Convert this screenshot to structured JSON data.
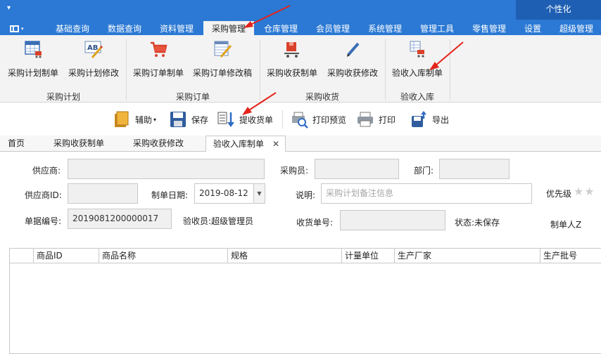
{
  "window": {
    "personalize_label": "个性化",
    "qat_symbol": "▾"
  },
  "menu_tabs": [
    {
      "label": "基础查询"
    },
    {
      "label": "数据查询"
    },
    {
      "label": "资料管理"
    },
    {
      "label": "采购管理",
      "active": true
    },
    {
      "label": "仓库管理"
    },
    {
      "label": "会员管理"
    },
    {
      "label": "系统管理"
    },
    {
      "label": "管理工具"
    },
    {
      "label": "零售管理"
    },
    {
      "label": "设置"
    },
    {
      "label": "超级管理"
    }
  ],
  "ribbon": {
    "groups": [
      {
        "title": "采购计划",
        "buttons": [
          {
            "label": "采购计划制单",
            "icon": "calendar-cart-icon"
          },
          {
            "label": "采购计划修改",
            "icon": "ab-edit-icon"
          }
        ]
      },
      {
        "title": "采购订单",
        "buttons": [
          {
            "label": "采购订单制单",
            "icon": "shopping-cart-icon"
          },
          {
            "label": "采购订单修改稿",
            "icon": "table-edit-icon"
          }
        ]
      },
      {
        "title": "采购收货",
        "buttons": [
          {
            "label": "采购收获制单",
            "icon": "box-cart-icon"
          },
          {
            "label": "采购收获修改",
            "icon": "pencil-icon"
          }
        ]
      },
      {
        "title": "验收入库",
        "buttons": [
          {
            "label": "验收入库制单",
            "icon": "warehouse-cart-icon"
          }
        ]
      }
    ]
  },
  "toolbar": {
    "assist_label": "辅助",
    "save_label": "保存",
    "pull_label": "提收货单",
    "preview_label": "打印预览",
    "print_label": "打印",
    "export_label": "导出"
  },
  "doc_tabs": [
    {
      "label": "首页"
    },
    {
      "label": "采购收获制单"
    },
    {
      "label": "采购收获修改"
    },
    {
      "label": "验收入库制单",
      "active": true,
      "closable": true
    }
  ],
  "doc_tab_close": "✕",
  "form": {
    "supplier_label": "供应商:",
    "supplier_value": "",
    "buyer_label": "采购员:",
    "buyer_value": "",
    "dept_label": "部门:",
    "dept_value": "",
    "supplier_id_label": "供应商ID:",
    "supplier_id_value": "",
    "date_label": "制单日期:",
    "date_value": "2019-08-12",
    "note_label": "说明:",
    "note_placeholder": "采购计划备注信息",
    "priority_label": "优先级",
    "priority_stars": "★★",
    "doc_no_label": "单据编号:",
    "doc_no_value": "2019081200000017",
    "inspector_label": "验收员:",
    "inspector_value": "超级管理员",
    "receipt_no_label": "收货单号:",
    "receipt_no_value": "",
    "status_label": "状态:",
    "status_value": "未保存",
    "maker_label": "制单人Z"
  },
  "grid": {
    "columns": [
      "商品ID",
      "商品名称",
      "规格",
      "计量单位",
      "生产厂家",
      "生产批号"
    ]
  },
  "colors": {
    "title_blue": "#2b79d4",
    "ribbon_bg": "#f3f3f3",
    "annotation_red": "#e3241b"
  }
}
